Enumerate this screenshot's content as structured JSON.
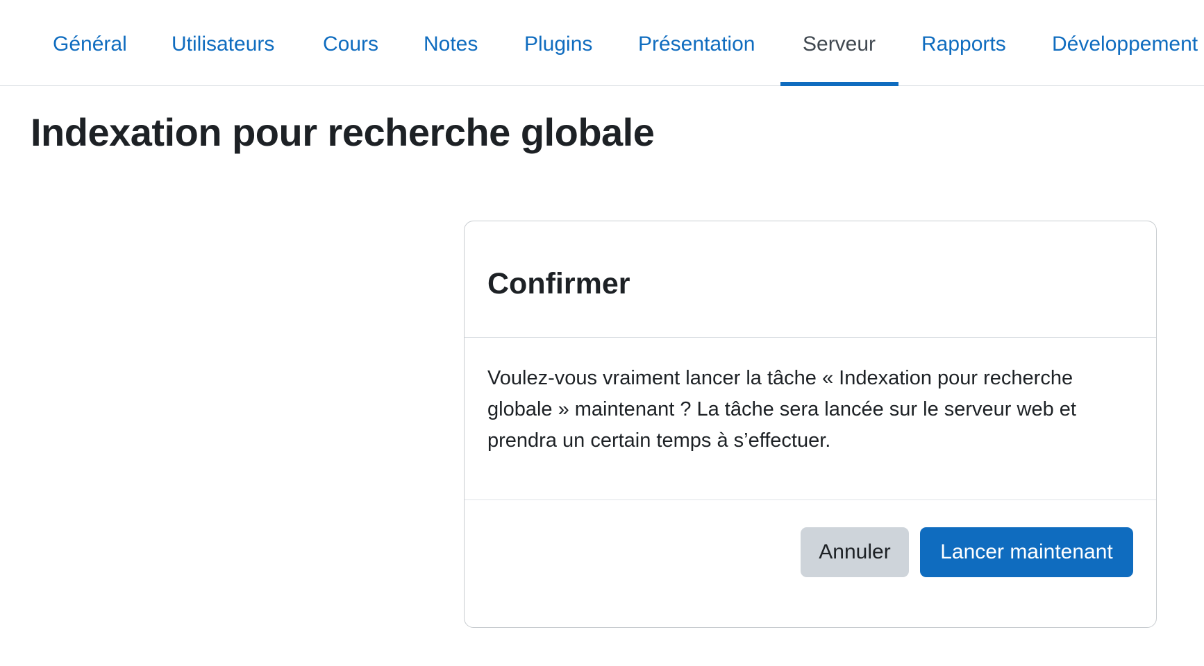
{
  "nav": {
    "tabs": [
      {
        "label": "Général"
      },
      {
        "label": "Utilisateurs"
      },
      {
        "label": "Cours"
      },
      {
        "label": "Notes"
      },
      {
        "label": "Plugins"
      },
      {
        "label": "Présentation"
      },
      {
        "label": "Serveur",
        "active": true
      },
      {
        "label": "Rapports"
      },
      {
        "label": "Développement"
      }
    ]
  },
  "page": {
    "title": "Indexation pour recherche globale"
  },
  "modal": {
    "title": "Confirmer",
    "message": "Voulez-vous vraiment lancer la tâche « Indexation pour recherche globale » maintenant ? La tâche sera lancée sur le serveur web et prendra un certain temps à s’effectuer.",
    "cancel_label": "Annuler",
    "confirm_label": "Lancer maintenant"
  },
  "colors": {
    "accent": "#0f6cbf",
    "text": "#1d2125",
    "active_tab_text": "#404850",
    "secondary_button": "#ced4da",
    "border": "#dee2e6"
  }
}
